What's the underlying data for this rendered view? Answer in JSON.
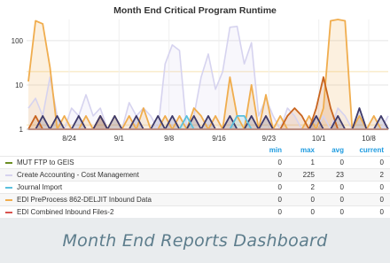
{
  "chart_data": {
    "type": "line",
    "title": "Month End Critical Program Runtime",
    "y_scale": "log",
    "ylim": [
      1,
      300
    ],
    "y_ticks": [
      1,
      10,
      100
    ],
    "y_tick_labels": [
      "1",
      "10",
      "100"
    ],
    "x_tick_labels": [
      "8/24",
      "9/1",
      "9/8",
      "9/16",
      "9/23",
      "10/1",
      "10/8"
    ],
    "threshold_lines": [
      20,
      1.25
    ],
    "grid": true,
    "legend": {
      "placement": "bottom",
      "columns": [
        "min",
        "max",
        "avg",
        "current"
      ]
    },
    "series": [
      {
        "name": "MUT FTP to GEIS",
        "color": "#6b8e23",
        "values": [
          1,
          1,
          1,
          1,
          1,
          1,
          1,
          1,
          1,
          1,
          1,
          1,
          1,
          1,
          1,
          1,
          1,
          1,
          1,
          1,
          1,
          1,
          1,
          1,
          1,
          1,
          1,
          1,
          1,
          1,
          1,
          1,
          1,
          1,
          1,
          1,
          1,
          1,
          1,
          1,
          1,
          1,
          1,
          1,
          1,
          1,
          1,
          1,
          1,
          1,
          1
        ],
        "stats": {
          "min": "0",
          "max": "1",
          "avg": "0",
          "current": "0"
        }
      },
      {
        "name": "Create Accounting - Cost Management",
        "color": "#d6d3ef",
        "values": [
          3,
          5,
          2,
          15,
          2,
          1,
          3,
          2,
          6,
          2,
          3,
          1,
          2,
          1,
          4,
          2,
          3,
          2,
          1,
          30,
          80,
          60,
          1,
          2,
          15,
          50,
          8,
          20,
          200,
          210,
          30,
          90,
          2,
          5,
          2,
          1,
          3,
          2,
          1,
          2,
          1,
          2,
          1,
          3,
          2,
          1,
          2,
          1,
          2,
          1,
          2
        ],
        "stats": {
          "min": "0",
          "max": "225",
          "avg": "23",
          "current": "2"
        }
      },
      {
        "name": "Journal Import",
        "color": "#5bc0de",
        "values": [
          1,
          1,
          1,
          1,
          1,
          1,
          1,
          1,
          1,
          1,
          1,
          1,
          1,
          1,
          1,
          1,
          1,
          1,
          1,
          1,
          1,
          1,
          2,
          1,
          1,
          1,
          1,
          1,
          1,
          2,
          2,
          1,
          1,
          1,
          1,
          1,
          1,
          1,
          1,
          1,
          1,
          1,
          1,
          1,
          1,
          1,
          1,
          1,
          1,
          1,
          1
        ],
        "stats": {
          "min": "0",
          "max": "2",
          "avg": "0",
          "current": "0"
        }
      },
      {
        "name": "EDI PreProcess 862-DELJIT Inbound Data",
        "color": "#f0ad4e",
        "values": [
          12,
          280,
          240,
          25,
          1,
          2,
          1,
          1,
          2,
          1,
          2,
          1,
          2,
          1,
          2,
          1,
          3,
          1,
          1,
          2,
          1,
          2,
          1,
          3,
          2,
          1,
          2,
          1,
          15,
          2,
          1,
          10,
          1,
          6,
          1,
          2,
          1,
          1,
          1,
          2,
          1,
          3,
          280,
          300,
          280,
          1,
          2,
          1,
          2,
          1,
          1
        ],
        "stats": {
          "min": "0",
          "max": "0",
          "avg": "0",
          "current": "0"
        }
      },
      {
        "name": "EDI Combined Inbound Files-2",
        "color": "#d9534f",
        "values": [
          1,
          1,
          1,
          1,
          1,
          1,
          1,
          1,
          1,
          1,
          1,
          1,
          1,
          1,
          1,
          1,
          1,
          1,
          1,
          1,
          1,
          1,
          1,
          1,
          1,
          1,
          1,
          1,
          1,
          1,
          1,
          1,
          1,
          1,
          1,
          1,
          1,
          1,
          1,
          1,
          1,
          1,
          1,
          1,
          1,
          1,
          1,
          1,
          1,
          1,
          1
        ],
        "stats": {
          "min": "0",
          "max": "0",
          "avg": "0",
          "current": "0"
        }
      },
      {
        "name": "",
        "color": "#3e3a6b",
        "values": [
          1,
          1,
          2,
          1,
          2,
          1,
          1,
          2,
          1,
          1,
          2,
          1,
          2,
          1,
          1,
          2,
          1,
          1,
          2,
          1,
          2,
          1,
          1,
          2,
          1,
          2,
          1,
          1,
          2,
          1,
          1,
          2,
          1,
          2,
          1,
          1,
          1,
          1,
          1,
          1,
          2,
          1,
          1,
          2,
          1,
          1,
          3,
          1,
          1,
          2,
          1
        ]
      },
      {
        "name": "",
        "color": "#c8641e",
        "values": [
          1,
          2,
          1,
          1,
          1,
          1,
          1,
          1,
          1,
          1,
          2,
          1,
          1,
          1,
          1,
          1,
          1,
          1,
          1,
          1,
          1,
          1,
          1,
          1,
          1,
          1,
          1,
          1,
          1,
          1,
          1,
          1,
          1,
          1,
          1,
          1,
          2,
          3,
          2,
          1,
          3,
          15,
          3,
          1,
          1,
          1,
          1,
          1,
          1,
          1,
          1
        ]
      }
    ]
  },
  "legend_header": {
    "min": "min",
    "max": "max",
    "avg": "avg",
    "current": "current"
  },
  "footer_title": "Month End Reports Dashboard"
}
